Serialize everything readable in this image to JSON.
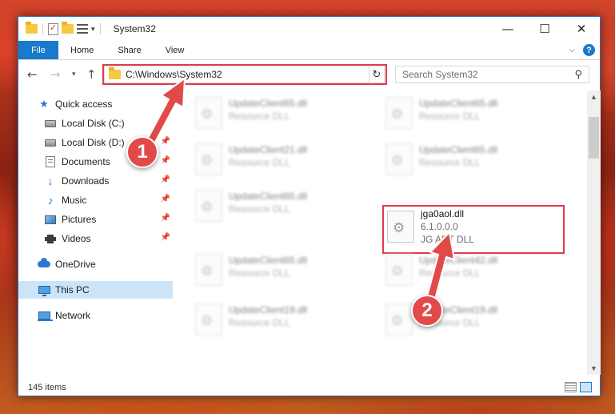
{
  "window": {
    "title": "System32",
    "controls": {
      "minimize": "—",
      "maximize": "☐",
      "close": "✕"
    }
  },
  "ribbon": {
    "tabs": [
      "File",
      "Home",
      "Share",
      "View"
    ]
  },
  "address_bar": {
    "path": "C:\\Windows\\System32",
    "search_placeholder": "Search System32"
  },
  "sidebar": {
    "items": [
      {
        "label": "Quick access",
        "icon": "star-icon",
        "pinned": false
      },
      {
        "label": "Local Disk (C:)",
        "icon": "disk-icon",
        "pinned": true
      },
      {
        "label": "Local Disk (D:)",
        "icon": "disk-icon",
        "pinned": true
      },
      {
        "label": "Documents",
        "icon": "document-icon",
        "pinned": true
      },
      {
        "label": "Downloads",
        "icon": "download-icon",
        "pinned": true
      },
      {
        "label": "Music",
        "icon": "music-icon",
        "pinned": true
      },
      {
        "label": "Pictures",
        "icon": "pictures-icon",
        "pinned": true
      },
      {
        "label": "Videos",
        "icon": "video-icon",
        "pinned": true
      },
      {
        "label": "OneDrive",
        "icon": "cloud-icon",
        "pinned": false
      },
      {
        "label": "This PC",
        "icon": "computer-icon",
        "pinned": false,
        "selected": true
      },
      {
        "label": "Network",
        "icon": "network-icon",
        "pinned": false
      }
    ]
  },
  "files": [
    {
      "name": "UpdateClient65.dll",
      "type": "Resource DLL"
    },
    {
      "name": "UpdateClient65.dll",
      "type": "Resource DLL"
    },
    {
      "name": "UpdateClient21.dll",
      "type": "Resource DLL"
    },
    {
      "name": "UpdateClient65.dll",
      "type": "Resource DLL"
    },
    {
      "name": "UpdateClient65.dll",
      "type": "Resource DLL"
    },
    {
      "name": "jga0aol.dll",
      "version": "6.1.0.0.0",
      "type": "JG ART DLL",
      "highlighted": true
    },
    {
      "name": "UpdateClient65.dll",
      "type": "Resource DLL"
    },
    {
      "name": "UpdateClient42.dll",
      "type": "Resource DLL"
    },
    {
      "name": "UpdateClient19.dll",
      "type": "Resource DLL"
    },
    {
      "name": "UpdateClient19.dll",
      "type": "Resource DLL"
    }
  ],
  "status": {
    "item_count": "145 items"
  },
  "callouts": [
    "1",
    "2"
  ],
  "colors": {
    "accent": "#1979ca",
    "highlight": "#e03c4a",
    "callout": "#e24a4a"
  }
}
